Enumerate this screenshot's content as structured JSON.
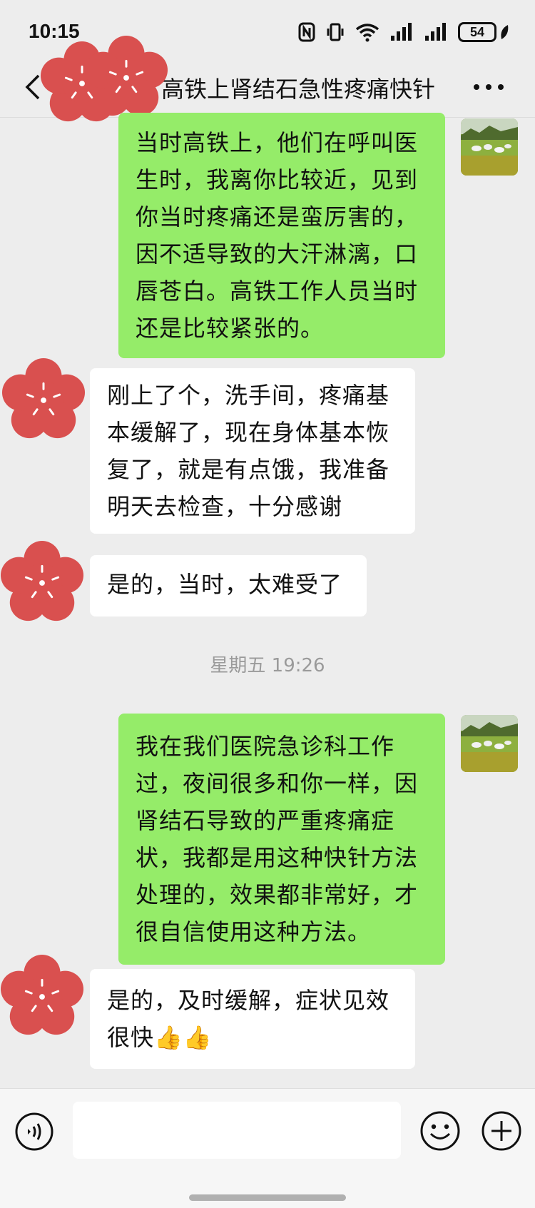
{
  "status_bar": {
    "time": "10:15",
    "battery": "54",
    "icons": [
      "nfc-icon",
      "vibrate-icon",
      "wifi-icon",
      "signal-icon",
      "signal-icon",
      "battery-icon",
      "leaf-icon"
    ]
  },
  "header": {
    "title": "高铁上肾结石急性疼痛快针",
    "icons": [
      "back-chevron-icon",
      "more-dots-icon"
    ]
  },
  "messages": [
    {
      "side": "me",
      "lines": [
        "当时高铁上，他们在呼叫医",
        "生时，我离你比较近，见到",
        "你当时疼痛还是蛮厉害的，",
        "因不适导致的大汗淋漓，口",
        "唇苍白。高铁工作人员当时",
        "还是比较紧张的。"
      ]
    },
    {
      "side": "them",
      "lines": [
        "刚上了个，洗手间，疼痛基",
        "本缓解了，现在身体基本恢",
        "复了，就是有点饿，我准备",
        "明天去检查，十分感谢"
      ]
    },
    {
      "side": "them",
      "lines": [
        "是的，当时，太难受了"
      ]
    },
    {
      "side": "me",
      "lines": [
        "我在我们医院急诊科工作",
        "过，夜间很多和你一样，因",
        "肾结石导致的严重疼痛症",
        "状，我都是用这种快针方法",
        "处理的，效果都非常好，才",
        "很自信使用这种方法。"
      ]
    },
    {
      "side": "them",
      "lines": [
        "是的，及时缓解，症状见效",
        "很快👍👍"
      ]
    }
  ],
  "timestamp": "星期五 19:26",
  "input_bar": {
    "input_value": "",
    "icons": [
      "voice-icon",
      "emoji-icon",
      "plus-icon"
    ]
  },
  "colors": {
    "background": "#ededed",
    "my_bubble": "#95ec69",
    "their_bubble": "#ffffff",
    "redaction": "#d9504f"
  }
}
